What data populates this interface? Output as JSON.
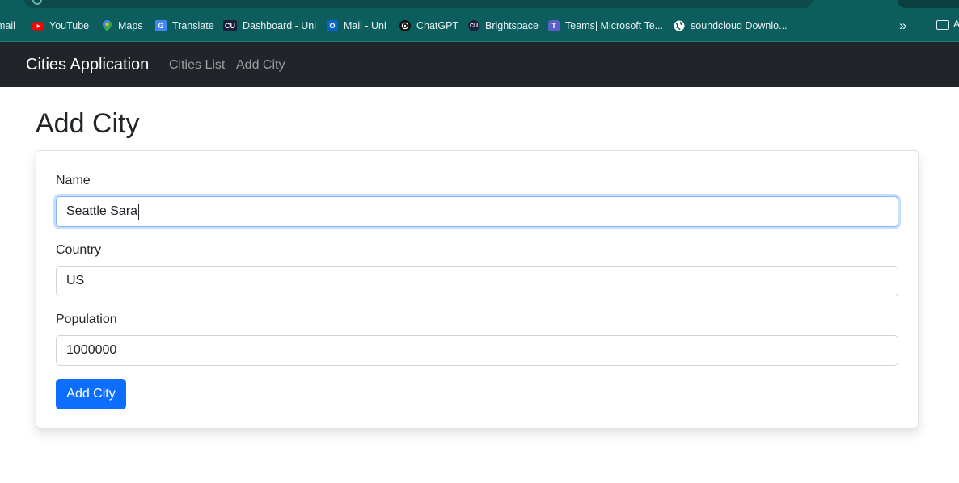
{
  "bookmarks": [
    {
      "label": "mail",
      "icon": "gmail-icon"
    },
    {
      "label": "YouTube",
      "icon": "youtube-icon"
    },
    {
      "label": "Maps",
      "icon": "maps-pin-icon"
    },
    {
      "label": "Translate",
      "icon": "translate-icon"
    },
    {
      "label": "Dashboard - Uni",
      "icon": "cu-logo-icon"
    },
    {
      "label": "Mail - Uni",
      "icon": "outlook-icon"
    },
    {
      "label": "ChatGPT",
      "icon": "chatgpt-icon"
    },
    {
      "label": "Brightspace",
      "icon": "brightspace-icon"
    },
    {
      "label": "Teams| Microsoft Te...",
      "icon": "teams-icon"
    },
    {
      "label": "soundcloud Downlo...",
      "icon": "globe-icon"
    }
  ],
  "bookmarks_overflow": "»",
  "bookmarks_folder": "A",
  "navbar": {
    "brand": "Cities Application",
    "links": [
      "Cities List",
      "Add City"
    ]
  },
  "page": {
    "title": "Add City"
  },
  "form": {
    "name_label": "Name",
    "name_value": "Seattle Sara",
    "country_label": "Country",
    "country_value": "US",
    "population_label": "Population",
    "population_value": "1000000",
    "submit_label": "Add City"
  },
  "colors": {
    "browser_bar": "#0b5d5e",
    "navbar": "#212529",
    "primary": "#0d6efd"
  }
}
